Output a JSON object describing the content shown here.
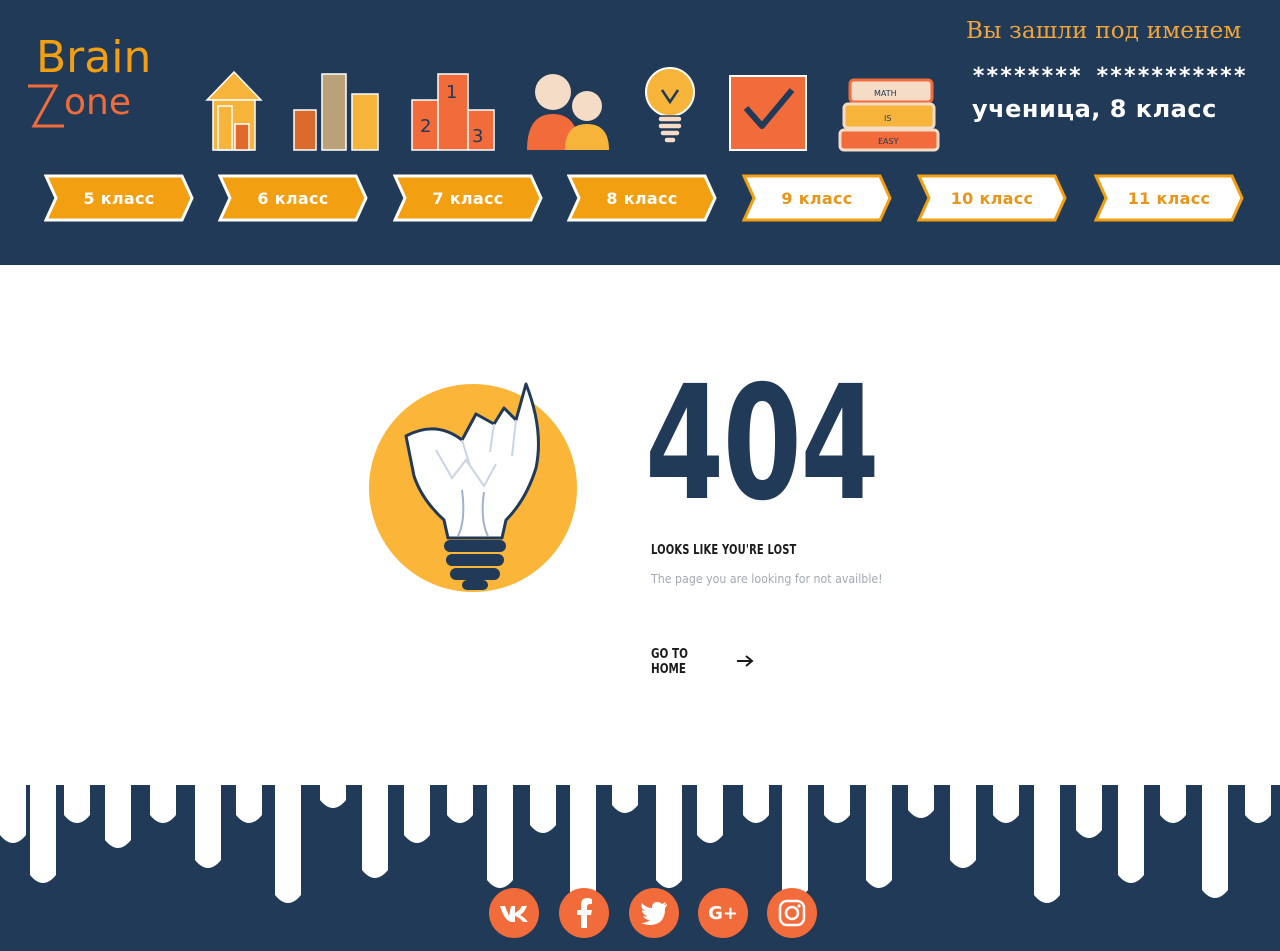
{
  "header": {
    "logo": {
      "line1": "Brain",
      "line2": "Zone"
    },
    "nav_icons": [
      "home-icon",
      "stats-icon",
      "podium-icon",
      "users-icon",
      "lightbulb-icon",
      "checkbox-icon",
      "books-icon"
    ],
    "books_labels": [
      "MATH",
      "IS",
      "EASY"
    ],
    "user": {
      "greeting": "Вы зашли под именем",
      "name": "******** ***********",
      "role": "ученица, 8 класс"
    },
    "grades": [
      {
        "label": "5 класс",
        "active": true
      },
      {
        "label": "6 класс",
        "active": true
      },
      {
        "label": "7 класс",
        "active": true
      },
      {
        "label": "8 класс",
        "active": true
      },
      {
        "label": "9 класс",
        "active": false
      },
      {
        "label": "10 класс",
        "active": false
      },
      {
        "label": "11 класс",
        "active": false
      }
    ],
    "colors": {
      "navy": "#213a58",
      "orange": "#f29f12",
      "accent": "#f26b3a"
    }
  },
  "error": {
    "code": "404",
    "title": "LOOKS LIKE YOU'RE LOST",
    "description": "The page you are looking for not availble!",
    "home_label": "GO TO HOME"
  },
  "footer": {
    "social": [
      {
        "name": "vk-icon",
        "glyph": "vk"
      },
      {
        "name": "facebook-icon",
        "glyph": "f"
      },
      {
        "name": "twitter-icon",
        "glyph": "t"
      },
      {
        "name": "google-plus-icon",
        "glyph": "G+"
      },
      {
        "name": "instagram-icon",
        "glyph": "ig"
      }
    ]
  }
}
